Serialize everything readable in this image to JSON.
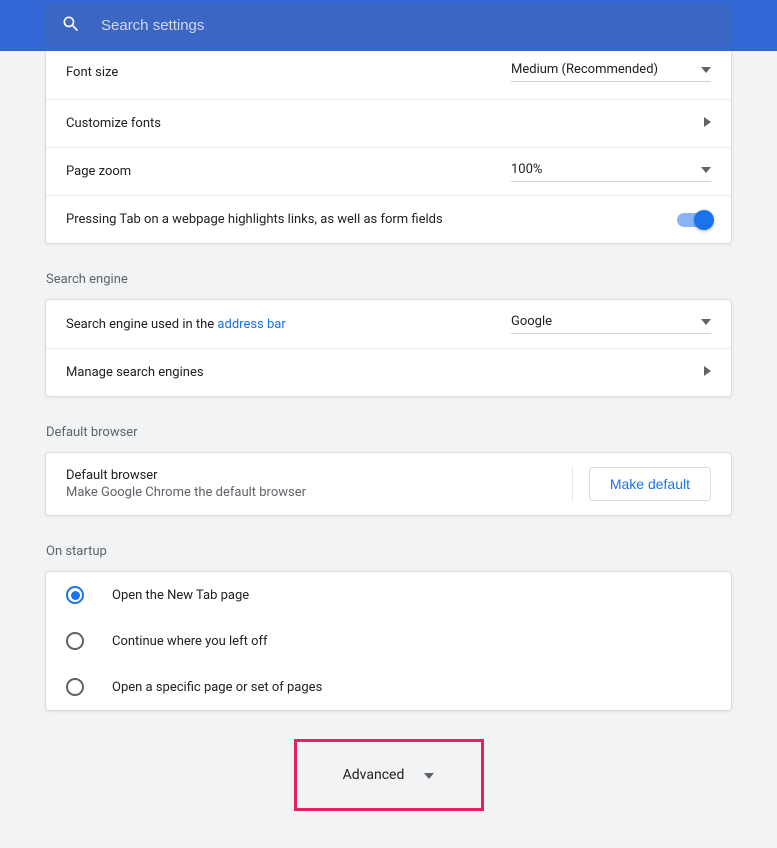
{
  "search": {
    "placeholder": "Search settings"
  },
  "appearance": {
    "font_size_label": "Font size",
    "font_size_value": "Medium (Recommended)",
    "customize_fonts_label": "Customize fonts",
    "page_zoom_label": "Page zoom",
    "page_zoom_value": "100%",
    "tab_highlight_label": "Pressing Tab on a webpage highlights links, as well as form fields"
  },
  "search_engine": {
    "title": "Search engine",
    "used_in_prefix": "Search engine used in the ",
    "address_bar_link": "address bar",
    "selected_engine": "Google",
    "manage_label": "Manage search engines"
  },
  "default_browser": {
    "title": "Default browser",
    "row_title": "Default browser",
    "row_subtitle": "Make Google Chrome the default browser",
    "button": "Make default"
  },
  "startup": {
    "title": "On startup",
    "options": [
      "Open the New Tab page",
      "Continue where you left off",
      "Open a specific page or set of pages"
    ],
    "selected_index": 0
  },
  "advanced": {
    "label": "Advanced"
  }
}
